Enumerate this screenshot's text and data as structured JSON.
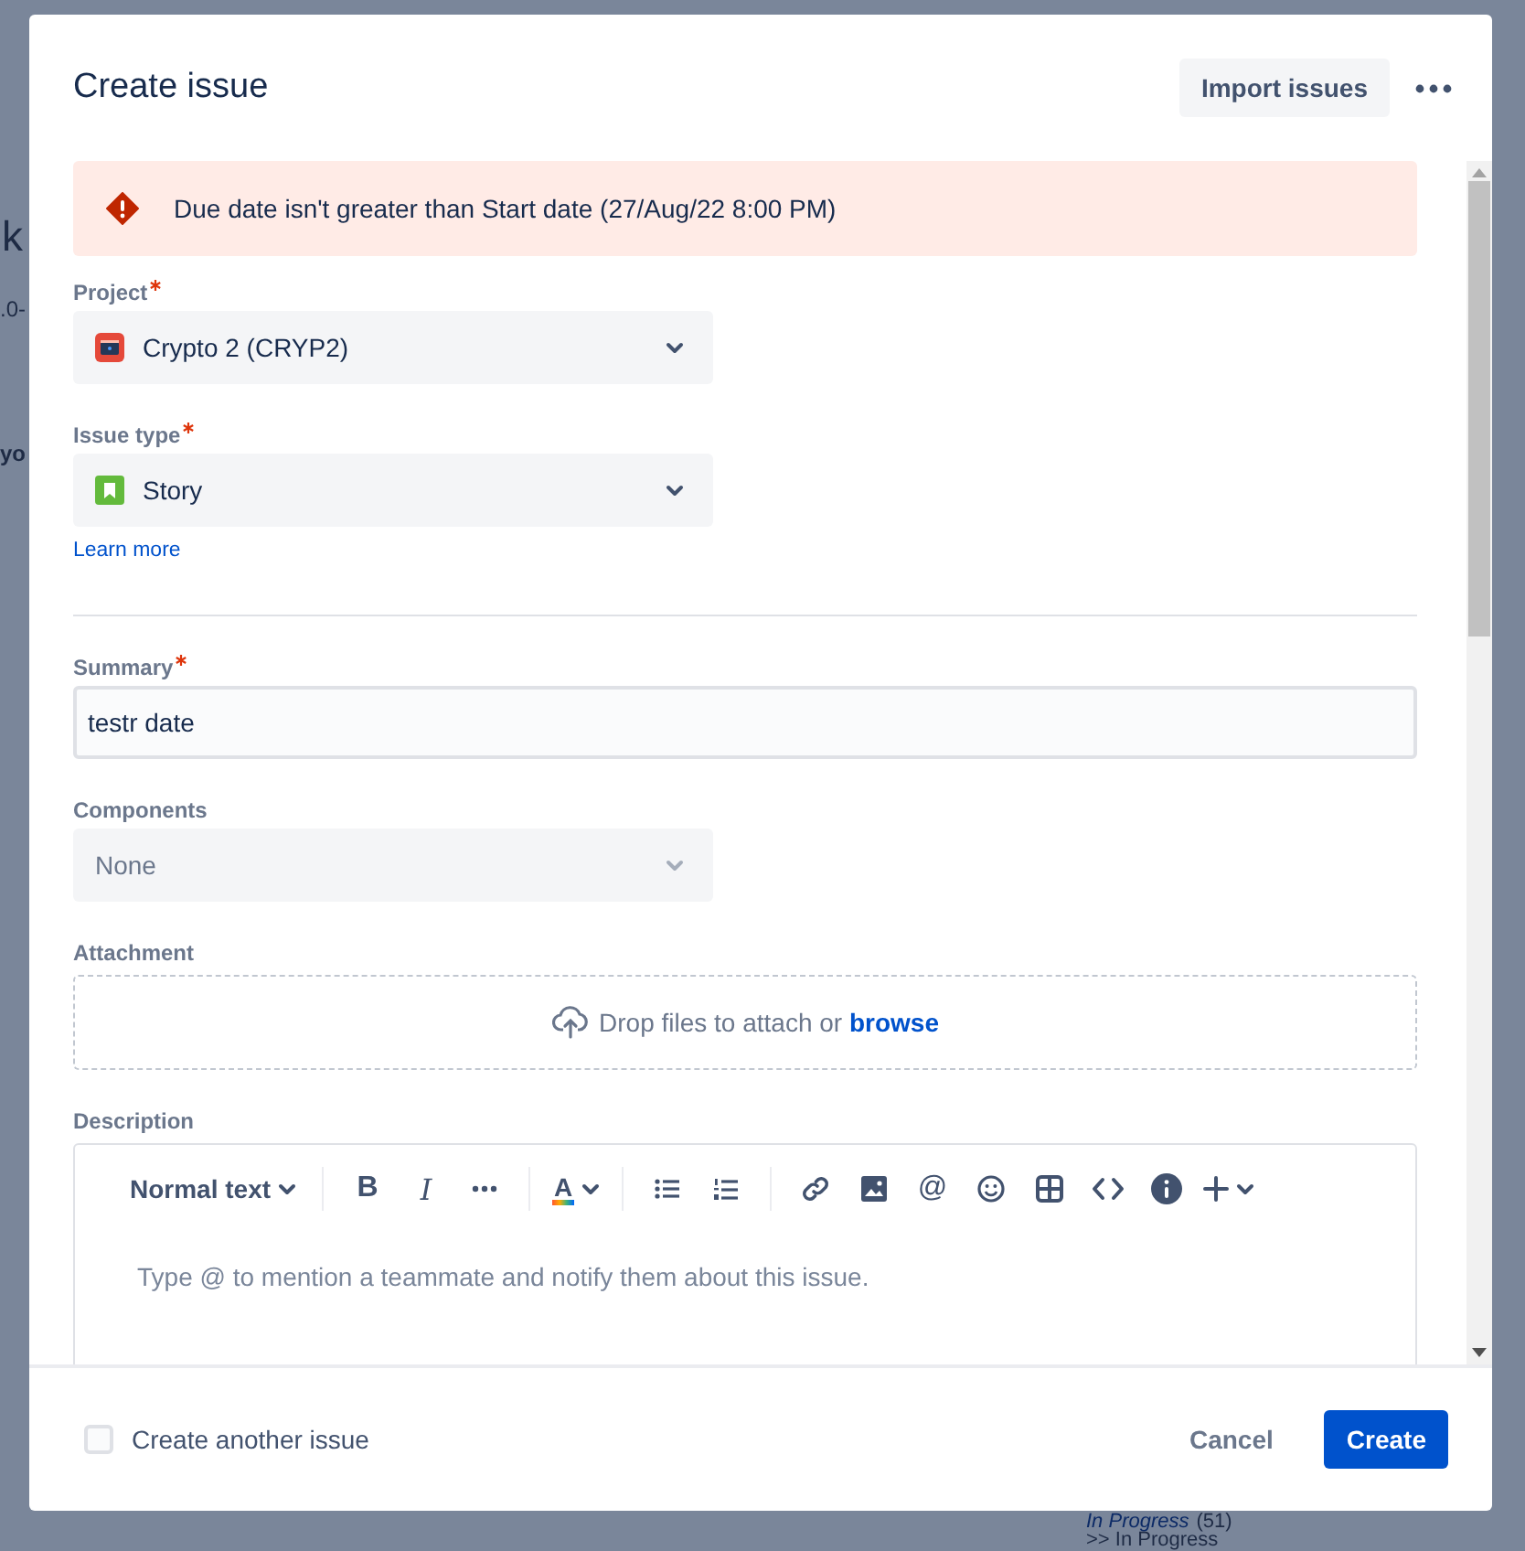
{
  "background": {
    "heading_fragment": "k",
    "version_fragment": ".0-",
    "bold_fragment": "yo",
    "status_link": "In Progress",
    "status_count": "(51)",
    "status_line": ">> In Progress"
  },
  "dialog": {
    "title": "Create issue",
    "import_button": "Import issues"
  },
  "error_banner": {
    "message": "Due date isn't greater than Start date (27/Aug/22 8:00 PM)"
  },
  "project": {
    "label": "Project",
    "required": true,
    "value": "Crypto 2 (CRYP2)"
  },
  "issue_type": {
    "label": "Issue type",
    "required": true,
    "value": "Story",
    "link": "Learn more"
  },
  "summary": {
    "label": "Summary",
    "required": true,
    "value": "testr date"
  },
  "components": {
    "label": "Components",
    "required": false,
    "placeholder": "None"
  },
  "attachment": {
    "label": "Attachment",
    "required": false,
    "hint": "Drop files to attach or",
    "link": "browse"
  },
  "description": {
    "label": "Description",
    "required": false,
    "text_style": "Normal text",
    "bold": "B",
    "italic": "I",
    "text_color": "A",
    "mention": "@",
    "placeholder": "Type @ to mention a teammate and notify them about this issue."
  },
  "footer": {
    "checkbox_label": "Create another issue",
    "checked": false,
    "cancel": "Cancel",
    "create": "Create"
  }
}
